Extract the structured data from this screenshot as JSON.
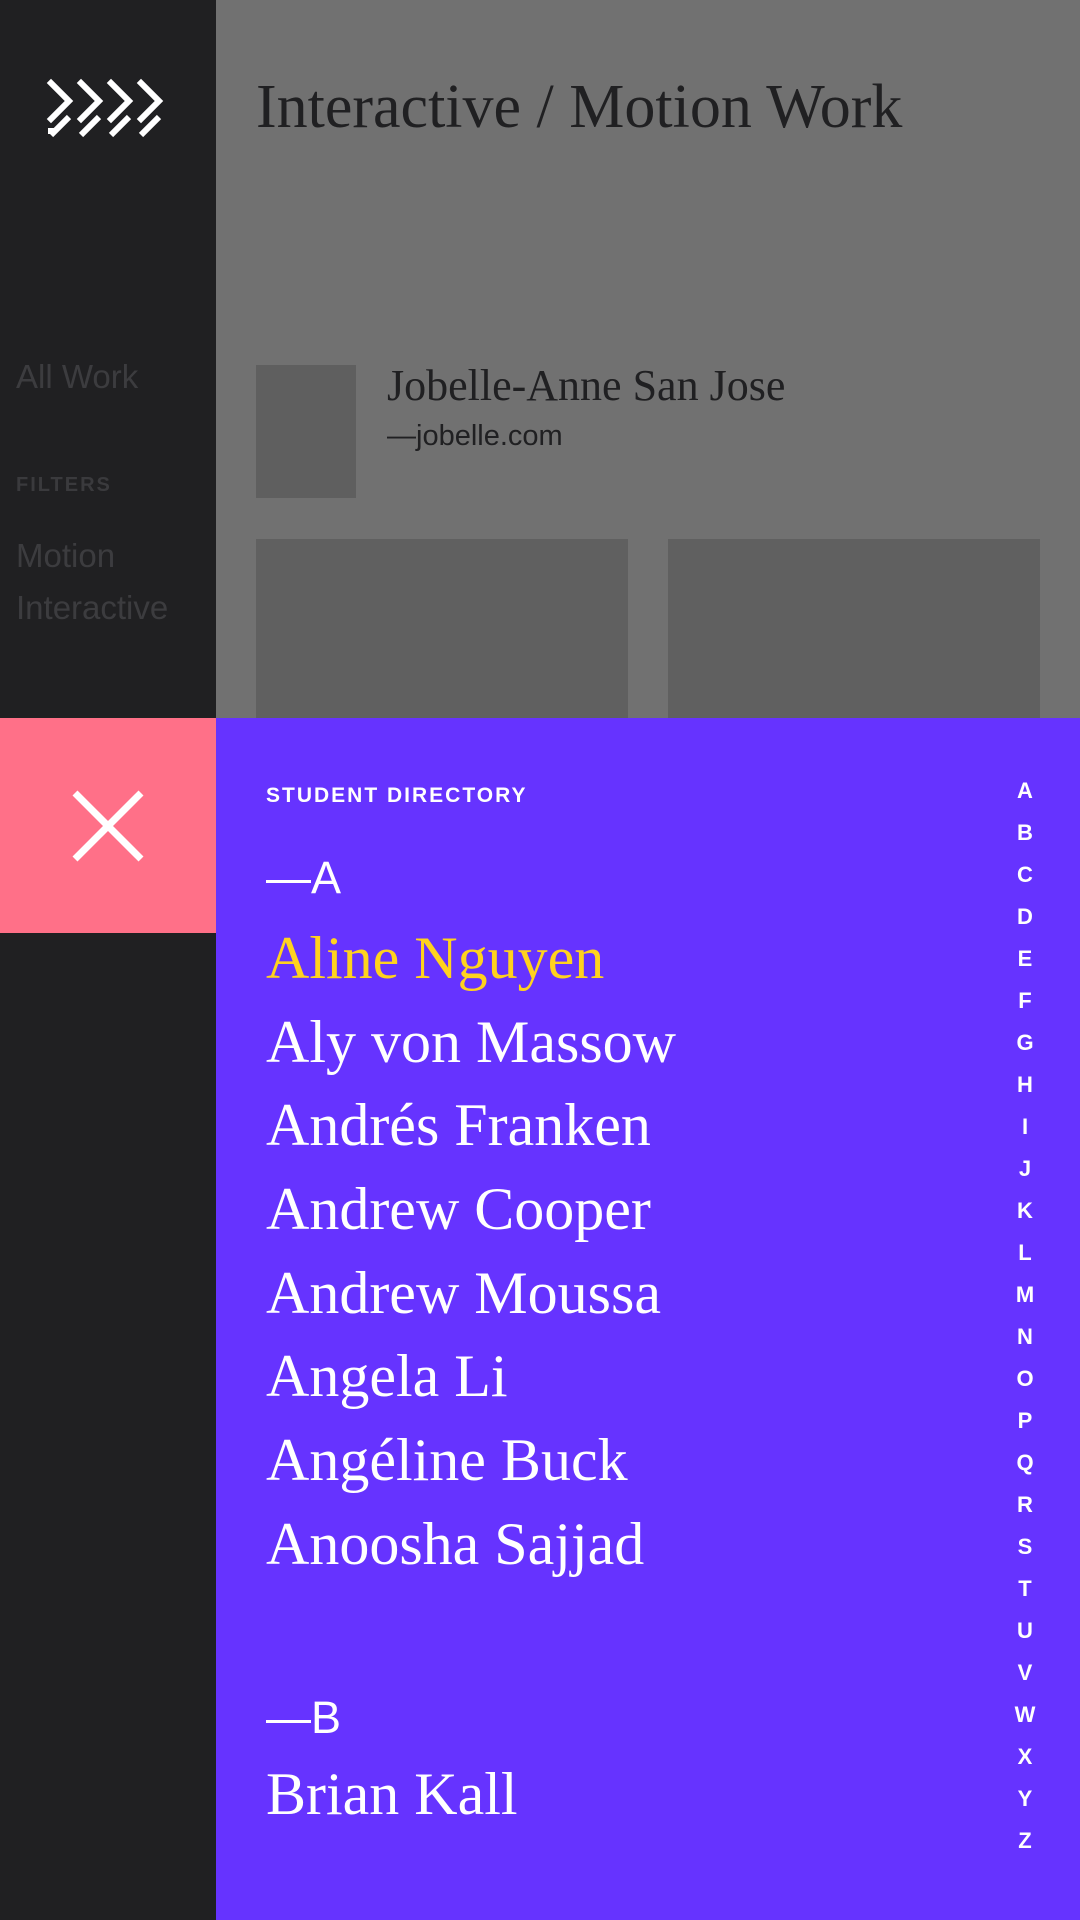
{
  "sidebar": {
    "logo_icon": "chevrons-logo-icon",
    "all_work": "All Work",
    "filters_heading": "FILTERS",
    "filters": [
      "Motion",
      "Interactive"
    ]
  },
  "main": {
    "title": "Interactive / Motion Work",
    "student": {
      "name": "Jobelle-Anne San Jose",
      "link": "—jobelle.com"
    }
  },
  "close_button": {
    "icon": "close-icon"
  },
  "directory": {
    "heading": "STUDENT DIRECTORY",
    "sections": [
      {
        "letter": "—A",
        "names": [
          "Aline Nguyen",
          "Aly von Massow",
          "Andrés Franken",
          "Andrew Cooper",
          "Andrew Moussa",
          "Angela Li",
          "Angéline Buck",
          "Anoosha Sajjad"
        ]
      },
      {
        "letter": "—B",
        "names": [
          "Brian Kall"
        ]
      }
    ],
    "highlighted_name": "Aline Nguyen",
    "alphabet": [
      "A",
      "B",
      "C",
      "D",
      "E",
      "F",
      "G",
      "H",
      "I",
      "J",
      "K",
      "L",
      "M",
      "N",
      "O",
      "P",
      "Q",
      "R",
      "S",
      "T",
      "U",
      "V",
      "W",
      "X",
      "Y",
      "Z"
    ]
  },
  "colors": {
    "sidebar_bg": "#202022",
    "directory_bg": "#6633ff",
    "close_bg": "#ff7088",
    "highlight": "#ffd21e",
    "dimmed_content": "#717171"
  }
}
